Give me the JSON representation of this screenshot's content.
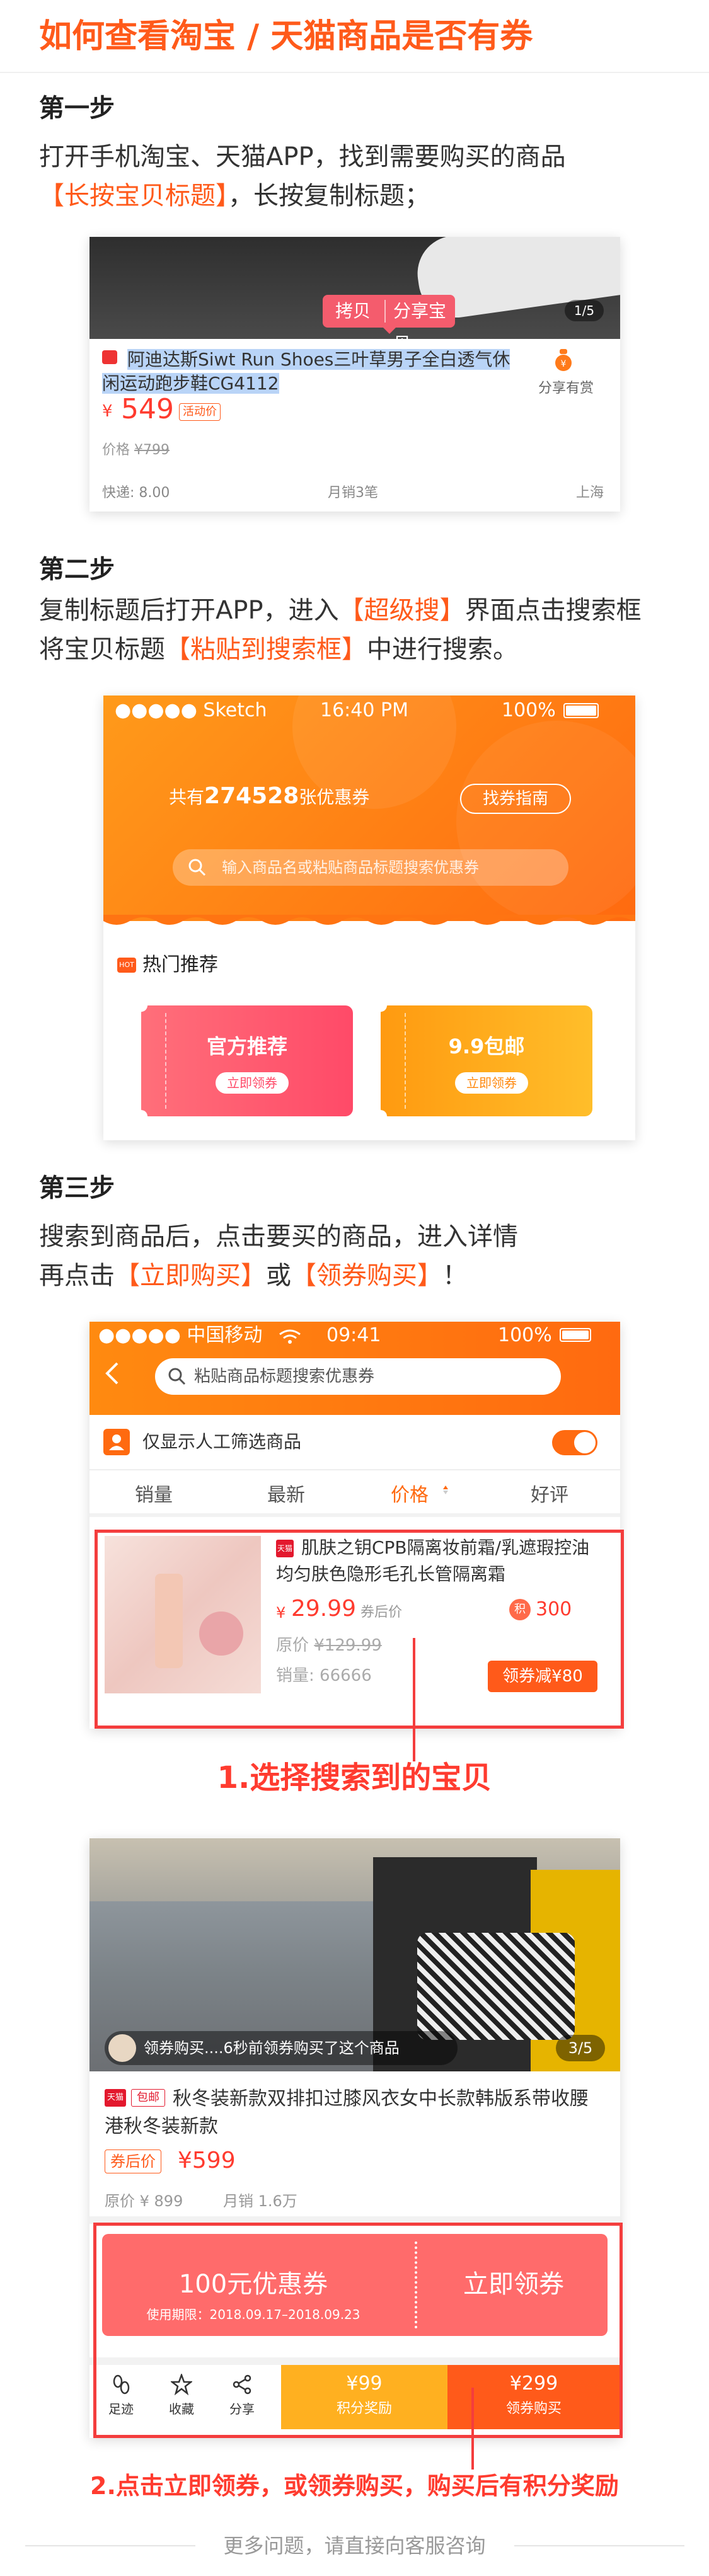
{
  "page_title": "如何查看淘宝 / 天猫商品是否有券",
  "step1": {
    "heading": "第一步",
    "line1": "打开手机淘宝、天猫APP，找到需要购买的商品",
    "line2_hl": "【长按宝贝标题】",
    "line2_rest": "，长按复制标题；",
    "popup_copy": "拷贝",
    "popup_share": "分享宝贝",
    "image_counter": "1/5",
    "product_title": "阿迪达斯Siwt Run Shoes三叶草男子全白透气休闲运动跑步鞋CG4112",
    "share_reward": "分享有赏",
    "price_symbol": "¥",
    "price": "549",
    "promo_tag": "活动价",
    "orig_label": "价格",
    "orig_price": "¥799",
    "shipping": "快递: 8.00",
    "monthly_sales": "月销3笔",
    "location": "上海"
  },
  "step2": {
    "heading": "第二步",
    "line1_a": "复制标题后打开APP，进入",
    "line1_hl": "【超级搜】",
    "line1_b": "界面点击搜索框",
    "line2_a": "将宝贝标题",
    "line2_hl": "【粘贴到搜索框】",
    "line2_b": "中进行搜索。",
    "status_carrier": "●●●●● Sketch",
    "status_time": "16:40 PM",
    "status_battery": "100%",
    "coupon_prefix": "共有",
    "coupon_count": "274528",
    "coupon_suffix": "张优惠券",
    "guide_button": "找券指南",
    "search_placeholder": "输入商品名或粘贴商品标题搜索优惠券",
    "hot_icon": "HOT",
    "hot_title": "热门推荐",
    "promo1_title": "官方推荐",
    "promo1_button": "立即领券",
    "promo2_title": "9.9包邮",
    "promo2_button": "立即领券"
  },
  "step3": {
    "heading": "第三步",
    "line1": "搜索到商品后，点击要买的商品，进入详情",
    "line2_a": "再点击",
    "line2_hl1": "【立即购买】",
    "line2_b": "或",
    "line2_hl2": "【领券购买】",
    "line2_c": "！",
    "status_carrier": "●●●●● 中国移动",
    "status_time": "09:41",
    "status_battery": "100%",
    "search_placeholder": "粘贴商品标题搜索优惠券",
    "filter_label": "仅显示人工筛选商品",
    "sort_tabs": [
      "销量",
      "最新",
      "价格",
      "好评"
    ],
    "product_tag": "天猫",
    "product_title": "肌肤之钥CPB隔离妆前霜/乳遮瑕控油均匀肤色隐形毛孔长管隔离霜",
    "price_symbol": "¥",
    "price": "29.99",
    "price_note": "券后价",
    "points_icon": "积",
    "points": "300",
    "orig_label": "原价",
    "orig_price": "¥129.99",
    "sales_label": "销量:",
    "sales": "66666",
    "coupon_btn": "领券减¥80",
    "annotation1": "1.选择搜索到的宝贝",
    "buyer_notice": "领券购买....6秒前领券购买了这个商品",
    "image_counter": "3/5",
    "detail_tag1": "天猫",
    "detail_tag2": "包邮",
    "detail_title": "秋冬装新款双排扣过膝风衣女中长款韩版系带收腰港秋冬装新款",
    "after_coupon_tag": "券后价",
    "detail_price": "¥599",
    "detail_orig": "原价 ¥ 899",
    "detail_sales": "月销 1.6万",
    "coupon_amount": "100元优惠券",
    "coupon_period": "使用期限：2018.09.17–2018.09.23",
    "coupon_claim": "立即领券",
    "bottom_footprint": "足迹",
    "bottom_favorite": "收藏",
    "bottom_share": "分享",
    "buy1_price": "¥99",
    "buy1_label": "积分奖励",
    "buy2_price": "¥299",
    "buy2_label": "领券购买",
    "annotation2": "2.点击立即领券，或领券购买，购买后有积分奖励"
  },
  "footer": "更多问题，请直接向客服咨询",
  "colors": {
    "accent": "#ff5a1a",
    "red": "#ff3b2f",
    "orange_bar": "#ff8a00",
    "yellow": "#ffb020"
  }
}
